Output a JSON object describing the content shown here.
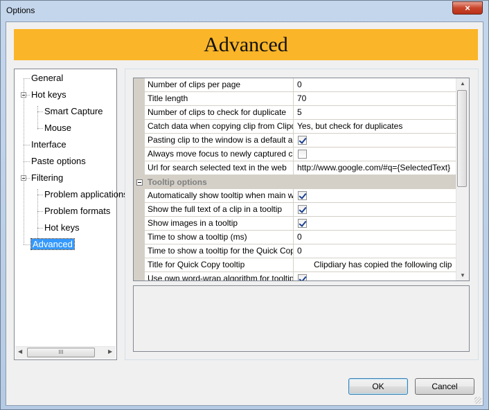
{
  "window": {
    "title": "Options",
    "close_symbol": "×"
  },
  "banner": {
    "title": "Advanced"
  },
  "tree": {
    "items": [
      {
        "label": "General",
        "level": 0,
        "expandable": false
      },
      {
        "label": "Hot keys",
        "level": 0,
        "expandable": true
      },
      {
        "label": "Smart Capture",
        "level": 1,
        "expandable": false
      },
      {
        "label": "Mouse",
        "level": 1,
        "expandable": false
      },
      {
        "label": "Interface",
        "level": 0,
        "expandable": false
      },
      {
        "label": "Paste options",
        "level": 0,
        "expandable": false
      },
      {
        "label": "Filtering",
        "level": 0,
        "expandable": true
      },
      {
        "label": "Problem applications",
        "level": 1,
        "expandable": false
      },
      {
        "label": "Problem formats",
        "level": 1,
        "expandable": false
      },
      {
        "label": "Hot keys",
        "level": 1,
        "expandable": false
      },
      {
        "label": "Advanced",
        "level": 0,
        "expandable": false,
        "selected": true
      }
    ],
    "hscroll_left": "◀",
    "hscroll_right": "▶",
    "hscroll_grip": "III"
  },
  "properties": {
    "rows": [
      {
        "name": "Number of clips per page",
        "value": "0"
      },
      {
        "name": "Title length",
        "value": "70"
      },
      {
        "name": "Number of clips to check for duplicate",
        "value": "5"
      },
      {
        "name": "Catch data when copying clip from Clipdiary",
        "value": "Yes, but check for duplicates"
      },
      {
        "name": "Pasting clip to the window is a default action",
        "checkbox": true
      },
      {
        "name": "Always move focus to newly captured clip",
        "checkbox": false
      },
      {
        "name": "Url for search selected text in the web",
        "value": "http://www.google.com/#q={SelectedText}"
      }
    ],
    "category": {
      "label": "Tooltip options",
      "toggle": "−"
    },
    "tooltip_rows": [
      {
        "name": "Automatically show tooltip when main window",
        "checkbox": true
      },
      {
        "name": "Show the full text of a clip in a tooltip",
        "checkbox": true
      },
      {
        "name": "Show images in a tooltip",
        "checkbox": true
      },
      {
        "name": "Time to show a tooltip (ms)",
        "value": "0"
      },
      {
        "name": "Time to show a tooltip for the Quick Copy",
        "value": "0"
      },
      {
        "name": "Title for Quick Copy tooltip",
        "value": "Clipdiary has copied the following clip",
        "indent": true
      },
      {
        "name": "Use own word-wrap algorithm for tooltips",
        "checkbox": true
      }
    ],
    "vscroll_up": "▲",
    "vscroll_down": "▼"
  },
  "buttons": {
    "ok": "OK",
    "cancel": "Cancel"
  }
}
